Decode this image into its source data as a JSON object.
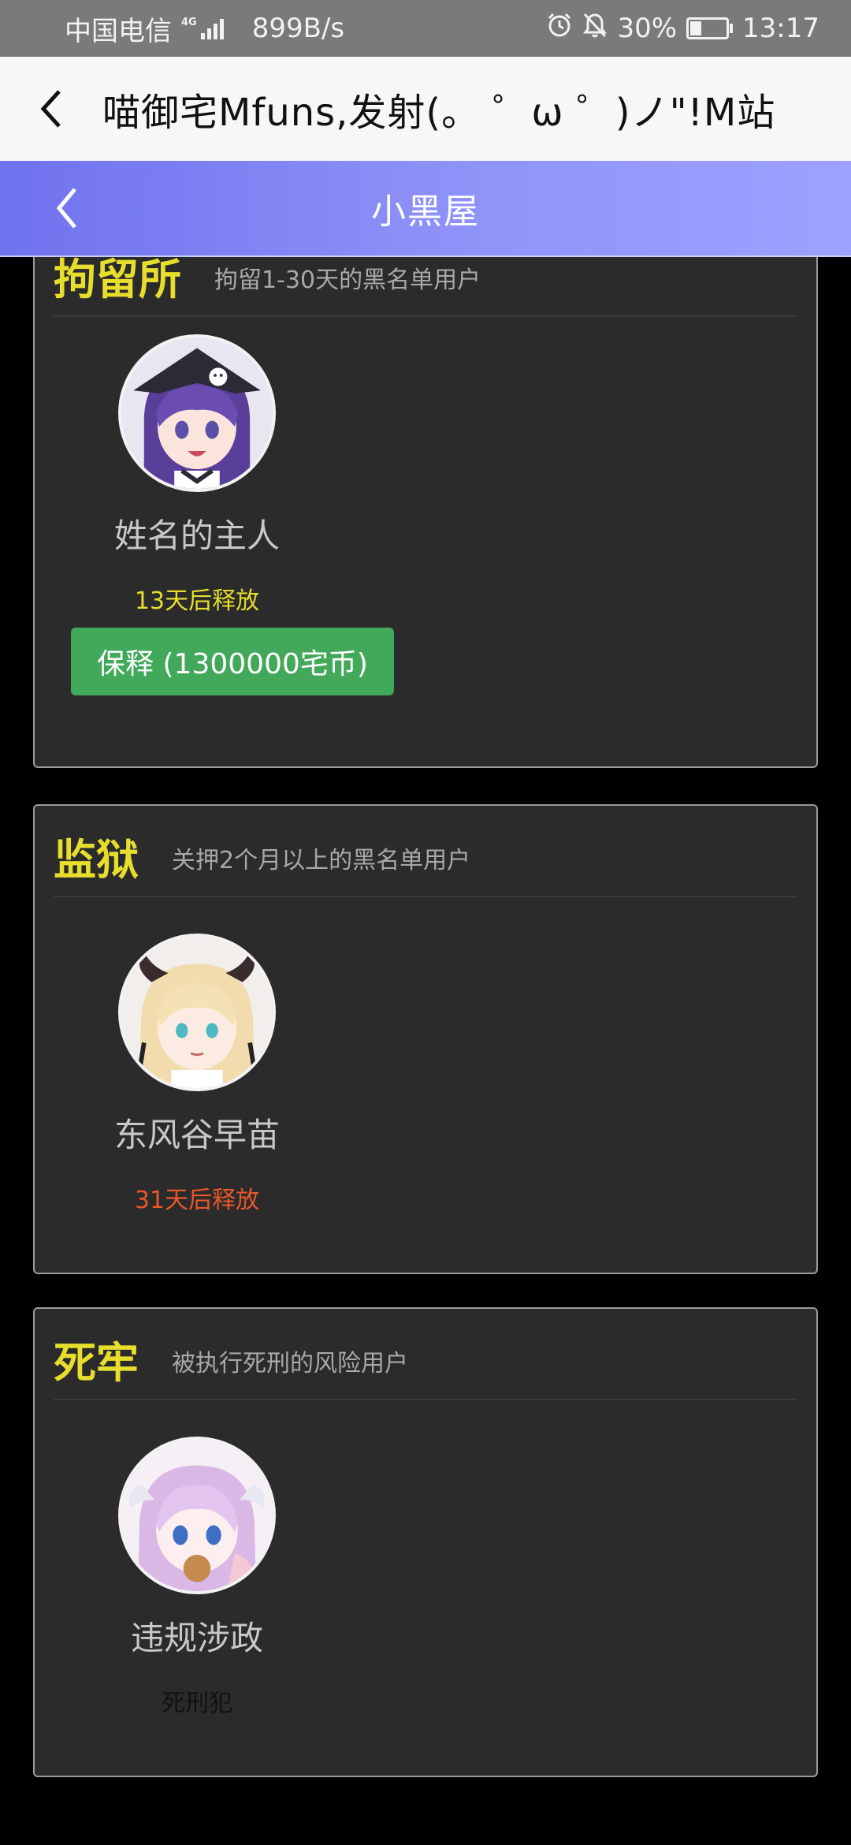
{
  "status_bar": {
    "carrier": "中国电信",
    "network": "4G",
    "speed": "899B/s",
    "battery": "30%",
    "time": "13:17"
  },
  "browser": {
    "title": "喵御宅Mfuns,发射(。 ゜ω ゜)ノ\"!M站"
  },
  "header": {
    "title": "小黑屋"
  },
  "sections": [
    {
      "title": "拘留所",
      "desc": "拘留1-30天的黑名单用户",
      "user": {
        "name": "姓名的主人",
        "status": "13天后释放",
        "status_color": "#e6dd2c",
        "avatar_icon": "purple-hair-witch-hat-avatar",
        "action": "保释 (1300000宅币)"
      }
    },
    {
      "title": "监狱",
      "desc": "关押2个月以上的黑名单用户",
      "user": {
        "name": "东风谷早苗",
        "status": "31天后释放",
        "status_color": "#e8572a",
        "avatar_icon": "blonde-horned-avatar"
      }
    },
    {
      "title": "死牢",
      "desc": "被执行死刑的风险用户",
      "user": {
        "name": "违规涉政",
        "status": "死刑犯",
        "status_color": "#111111",
        "avatar_icon": "pink-hair-dragon-avatar"
      }
    }
  ],
  "colors": {
    "header_gradient_start": "#6f72ee",
    "header_gradient_end": "#9ea1ff",
    "section_title": "#e6dd2c",
    "bail_button": "#42a85a",
    "card_bg": "#2b2b2b"
  }
}
